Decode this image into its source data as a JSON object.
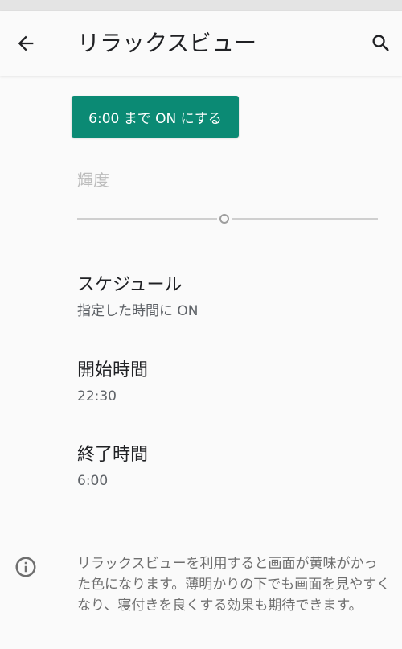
{
  "app_bar": {
    "title": "リラックスビュー",
    "back_icon": "arrow-back-icon",
    "search_icon": "search-icon"
  },
  "action_button": {
    "label": "6:00 まで ON にする",
    "color": "#0b8a74"
  },
  "brightness": {
    "label": "輝度",
    "level_fraction": 0.49,
    "enabled": false
  },
  "settings": {
    "schedule": {
      "title": "スケジュール",
      "summary": "指定した時間に ON"
    },
    "start_time": {
      "title": "開始時間",
      "summary": "22:30"
    },
    "end_time": {
      "title": "終了時間",
      "summary": "6:00"
    }
  },
  "info": {
    "icon": "info-icon",
    "text": "リラックスビューを利用すると画面が黄味がかった色になります。薄明かりの下でも画面を見やすくなり、寝付きを良くする効果も期待できます。"
  }
}
